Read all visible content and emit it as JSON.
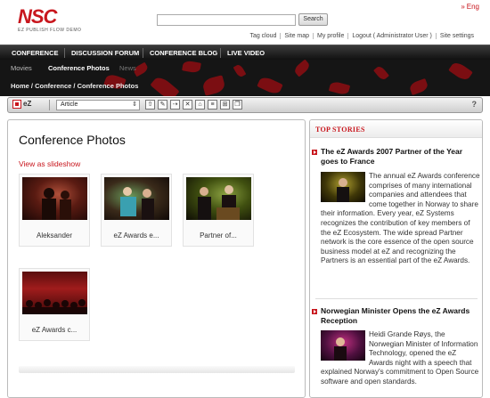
{
  "header": {
    "logo_main": "NSC",
    "logo_sub": "EZ PUBLISH FLOW DEMO",
    "lang_label": "Eng",
    "search": {
      "value": "",
      "button": "Search"
    },
    "toplinks": [
      "Tag cloud",
      "Site map",
      "My profile",
      "Logout ( Administrator User )",
      "Site settings"
    ]
  },
  "nav": {
    "items": [
      "CONFERENCE",
      "DISCUSSION FORUM",
      "CONFERENCE BLOG",
      "LIVE VIDEO"
    ]
  },
  "subnav": {
    "items": [
      "Movies",
      "Conference Photos",
      "News"
    ]
  },
  "breadcrumb": "Home / Conference / Conference Photos",
  "toolbar": {
    "logo": "eZ",
    "select_value": "Article",
    "help": "?"
  },
  "main": {
    "title": "Conference Photos",
    "slideshow_link": "View as slideshow",
    "photos": [
      {
        "caption": "Aleksander"
      },
      {
        "caption": "eZ Awards e..."
      },
      {
        "caption": "Partner of..."
      },
      {
        "caption": "eZ Awards c..."
      }
    ]
  },
  "side": {
    "heading": "TOP STORIES",
    "stories": [
      {
        "title": "The eZ Awards 2007 Partner of the Year goes to France",
        "body": "The annual eZ Awards conference comprises of many international companies and attendees that come together in Norway to share their information. Every year, eZ Systems recognizes the contribution of key members of the eZ Ecosystem. The wide spread Partner network is the core essence of the open source business model at eZ and recognizing the Partners is an essential part of the eZ Awards."
      },
      {
        "title": "Norwegian Minister Opens the eZ Awards Reception",
        "body": "Heidi Grande Røys, the Norwegian Minister of Information Technology, opened the eZ Awards night with a speech that explained Norway's commitment to Open Source software and open standards."
      }
    ]
  },
  "colors": {
    "brand_red": "#c8161d",
    "nav_dark": "#1b1b1b"
  }
}
